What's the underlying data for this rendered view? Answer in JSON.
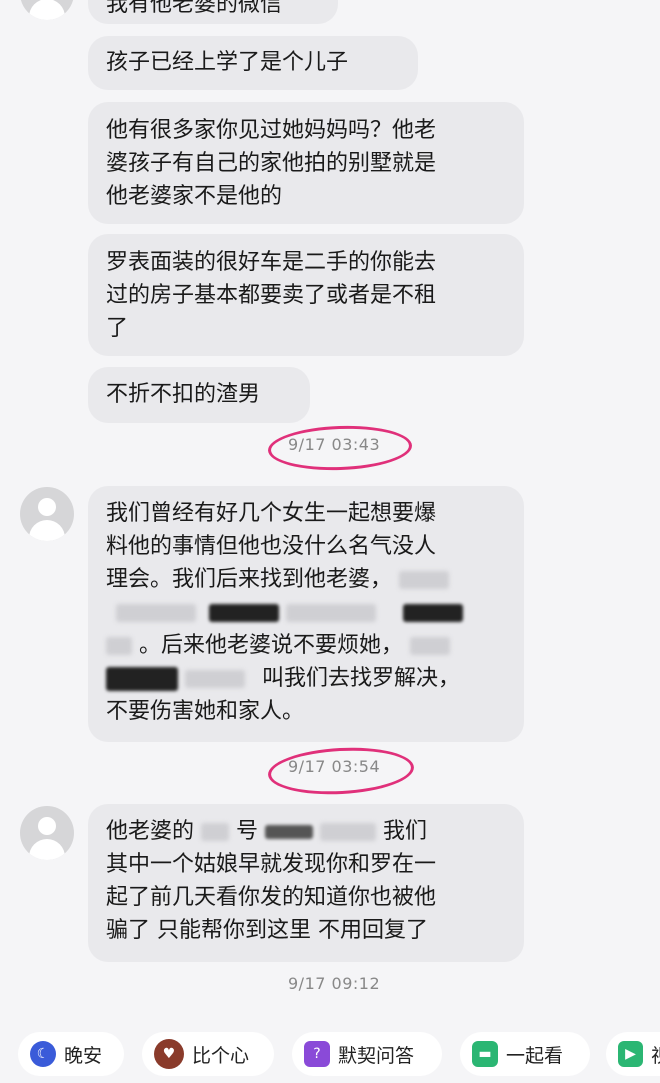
{
  "messages": {
    "top_partial": "我有他老婆的微信",
    "m1": "孩子已经上学了是个儿子",
    "m2_l1": "他有很多家你见过她妈妈吗？他老",
    "m2_l2": "婆孩子有自己的家他拍的别墅就是",
    "m2_l3": "他老婆家不是他的",
    "m3_l1": "罗表面装的很好车是二手的你能去",
    "m3_l2": "过的房子基本都要卖了或者是不租",
    "m3_l3": "了",
    "m4": "不折不扣的渣男",
    "ts1": "9/17 03:43",
    "m5_l1": "我们曾经有好几个女生一起想要爆",
    "m5_l2": "料他的事情但他也没什么名气没人",
    "m5_l3": "理会。我们后来找到他老婆，",
    "m5_l4": "",
    "m5_l5": "。后来他老婆说不要烦她，",
    "m5_l6": "叫我们去找罗解决，",
    "m5_l7": "不要伤害她和家人。",
    "ts2": "9/17 03:54",
    "m6_l1a": "他老婆的",
    "m6_l1b": "号",
    "m6_l1c": "我们",
    "m6_l2": "其中一个姑娘早就发现你和罗在一",
    "m6_l3": "起了前几天看你发的知道你也被他",
    "m6_l4": "骗了  只能帮你到这里 不用回复了",
    "ts3": "9/17 09:12"
  },
  "quick_actions": [
    {
      "label": "晚安",
      "icon": "moon-icon"
    },
    {
      "label": "比个心",
      "icon": "avatar-heart-icon"
    },
    {
      "label": "默契问答",
      "icon": "question-icon"
    },
    {
      "label": "一起看",
      "icon": "sofa-icon"
    },
    {
      "label": "视",
      "icon": "video-icon"
    }
  ],
  "colors": {
    "bubble": "#e9e9ec",
    "highlight": "#e0307a",
    "background": "#f5f5f7"
  }
}
